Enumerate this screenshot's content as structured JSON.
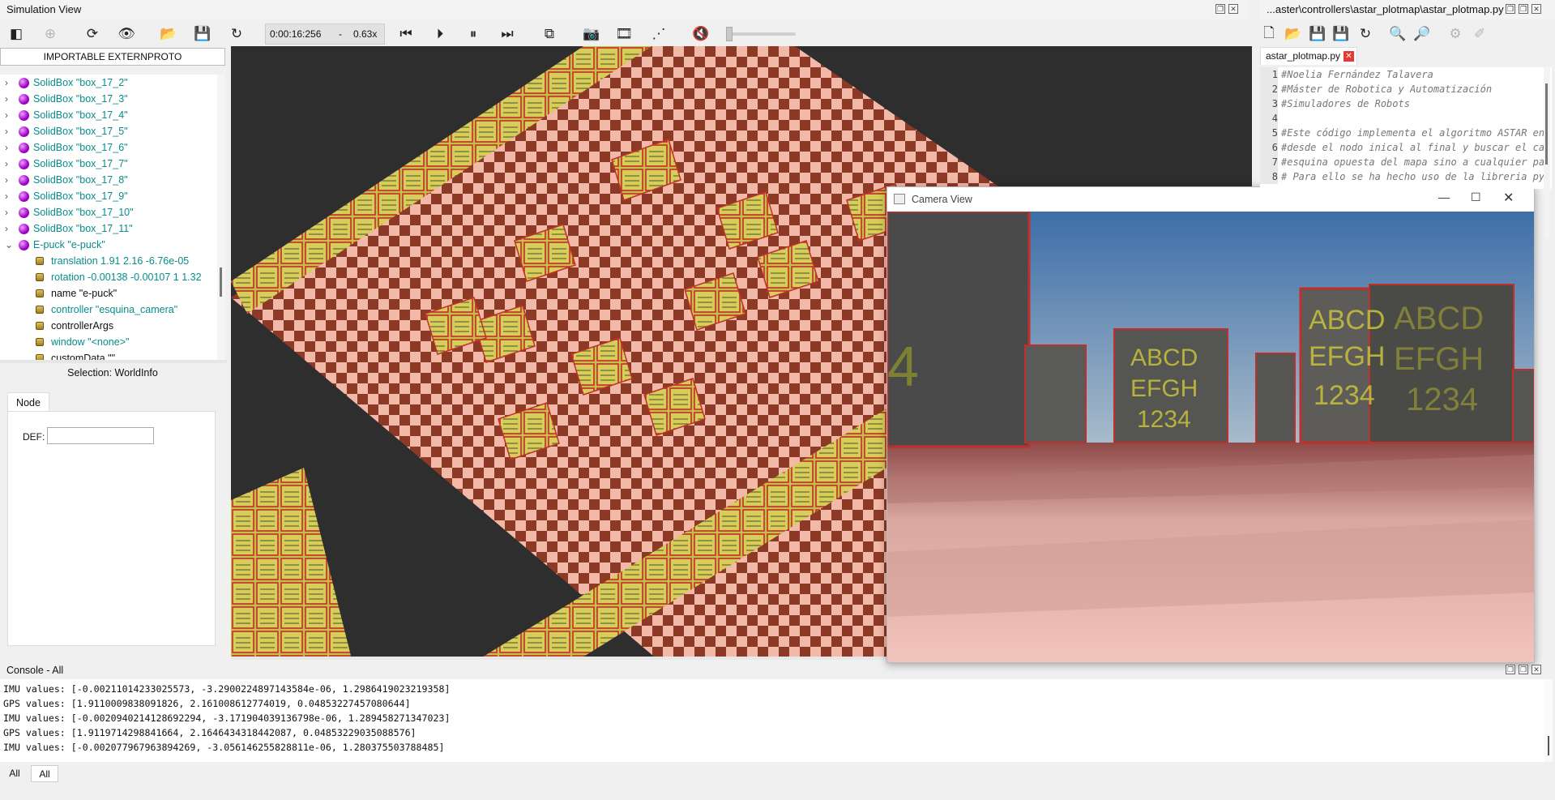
{
  "sim_panel": {
    "title": "Simulation View"
  },
  "toolbar": {
    "time": "0:00:16:256",
    "separator": "-",
    "speed": "0.63x"
  },
  "scene_tree": {
    "header_button": "IMPORTABLE EXTERNPROTO",
    "nodes": [
      {
        "label": "SolidBox \"box_17_2\""
      },
      {
        "label": "SolidBox \"box_17_3\""
      },
      {
        "label": "SolidBox \"box_17_4\""
      },
      {
        "label": "SolidBox \"box_17_5\""
      },
      {
        "label": "SolidBox \"box_17_6\""
      },
      {
        "label": "SolidBox \"box_17_7\""
      },
      {
        "label": "SolidBox \"box_17_8\""
      },
      {
        "label": "SolidBox \"box_17_9\""
      },
      {
        "label": "SolidBox \"box_17_10\""
      },
      {
        "label": "SolidBox \"box_17_11\""
      },
      {
        "label": "E-puck \"e-puck\""
      }
    ],
    "fields": [
      {
        "label": "translation 1.91 2.16 -6.76e-05",
        "color": "#078c8c"
      },
      {
        "label": "rotation -0.00138 -0.00107 1 1.32",
        "color": "#078c8c"
      },
      {
        "label": "name \"e-puck\"",
        "color": "#111111"
      },
      {
        "label": "controller \"esquina_camera\"",
        "color": "#078c8c"
      },
      {
        "label": "controllerArgs",
        "color": "#111111"
      },
      {
        "label": "window \"<none>\"",
        "color": "#078c8c"
      },
      {
        "label": "customData \"\"",
        "color": "#111111"
      }
    ]
  },
  "selection": {
    "title": "Selection: WorldInfo",
    "tab": "Node",
    "def_label": "DEF:",
    "def_value": ""
  },
  "camera_window": {
    "title": "Camera View"
  },
  "editor": {
    "path": "...aster\\controllers\\astar_plotmap\\astar_plotmap.py",
    "tab": "astar_plotmap.py",
    "lines": [
      {
        "n": "1",
        "text": "#Noelia Fernández Talavera"
      },
      {
        "n": "2",
        "text": "#Máster de Robotica y Automatización"
      },
      {
        "n": "3",
        "text": "#Simuladores de Robots"
      },
      {
        "n": "4",
        "text": ""
      },
      {
        "n": "5",
        "text": "#Este código implementa el algoritmo ASTAR en"
      },
      {
        "n": "6",
        "text": "#desde el nodo inical al final y buscar el ca"
      },
      {
        "n": "7",
        "text": "#esquina opuesta del mapa sino a cualquier pa"
      },
      {
        "n": "8",
        "text": "# Para ello se ha hecho uso de la libreria py"
      }
    ]
  },
  "console": {
    "title": "Console - All",
    "lines": [
      "IMU values: [-0.00211014233025573, -3.2900224897143584e-06, 1.2986419023219358]",
      "GPS values: [1.9110009838091826, 2.161008612774019, 0.04853227457080644]",
      "IMU values: [-0.0020940214128692294, -3.171904039136798e-06, 1.289458271347023]",
      "GPS values: [1.9119714298841664, 2.1646434318442087, 0.04853229035088576]",
      "IMU values: [-0.002077967963894269, -3.056146255828811e-06, 1.280375503788485]"
    ],
    "tabs": [
      "All",
      "All"
    ]
  },
  "colors": {
    "accent": "#078c8c",
    "close_red": "#e53935",
    "node_purple": "#a000c8"
  }
}
